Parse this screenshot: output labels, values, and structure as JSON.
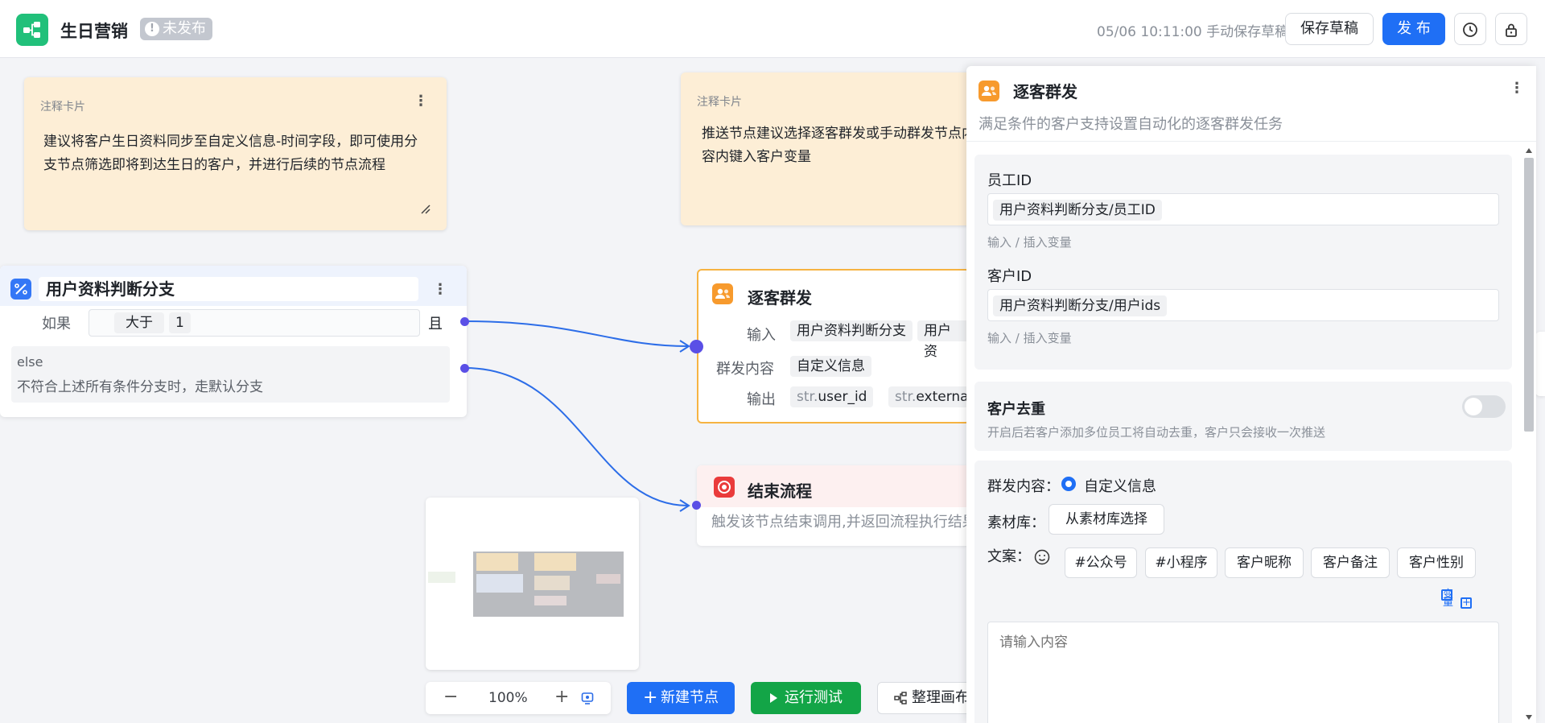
{
  "header": {
    "title": "生日营销",
    "status": "未发布",
    "save_info": "05/06 10:11:00 手动保存草稿",
    "save_draft": "保存草稿",
    "publish": "发 布"
  },
  "notes": [
    {
      "label": "注释卡片",
      "text": "建议将客户生日资料同步至自定义信息-时间字段，即可使用分支节点筛选即将到达生日的客户，并进行后续的节点流程"
    },
    {
      "label": "注释卡片",
      "text": "推送节点建议选择逐客群发或手动群发节点内容内键入客户变量"
    }
  ],
  "branch_node": {
    "title": "用户资料判断分支",
    "if_label": "如果",
    "operator": "大于",
    "value": "1",
    "and_label": "且",
    "else_title": "else",
    "else_desc": "不符合上述所有条件分支时，走默认分支"
  },
  "mass_node": {
    "title": "逐客群发",
    "input_label": "输入",
    "input_values": [
      "用户资料判断分支",
      "用户资"
    ],
    "content_label": "群发内容",
    "content_value": "自定义信息",
    "output_label": "输出",
    "output_values": [
      {
        "prefix": "str.",
        "name": "user_id"
      },
      {
        "prefix": "str.",
        "name": "external_"
      }
    ]
  },
  "end_node": {
    "title": "结束流程",
    "desc": "触发该节点结束调用,并返回流程执行结果"
  },
  "toolbar": {
    "zoom": "100%",
    "new_node": "新建节点",
    "run_test": "运行测试",
    "arrange": "整理画布"
  },
  "panel": {
    "title": "逐客群发",
    "desc": "满足条件的客户支持设置自动化的逐客群发任务",
    "staff_id_label": "员工ID",
    "staff_id_value": "用户资料判断分支/员工ID",
    "staff_id_hint": "输入 / 插入变量",
    "customer_id_label": "客户ID",
    "customer_id_value": "用户资料判断分支/用户ids",
    "customer_id_hint": "输入 / 插入变量",
    "dedup_title": "客户去重",
    "dedup_desc": "开启后若客户添加多位员工将自动去重，客户只会接收一次推送",
    "dedup_on": false,
    "content_label": "群发内容：",
    "content_option": "自定义信息",
    "library_label": "素材库：",
    "library_btn": "从素材库选择",
    "copy_label": "文案：",
    "tags": [
      "#公众号",
      "#小程序",
      "客户昵称",
      "客户备注",
      "客户性别"
    ],
    "var_link": "变量",
    "textarea_placeholder": "请输入内容"
  },
  "colors": {
    "primary": "#1f6ff5",
    "success": "#13a547",
    "brand": "#21c07a",
    "note": "#fdeed6",
    "mass_border": "#f6b342",
    "edge": "#2c6de8",
    "port": "#5a4fe6"
  }
}
